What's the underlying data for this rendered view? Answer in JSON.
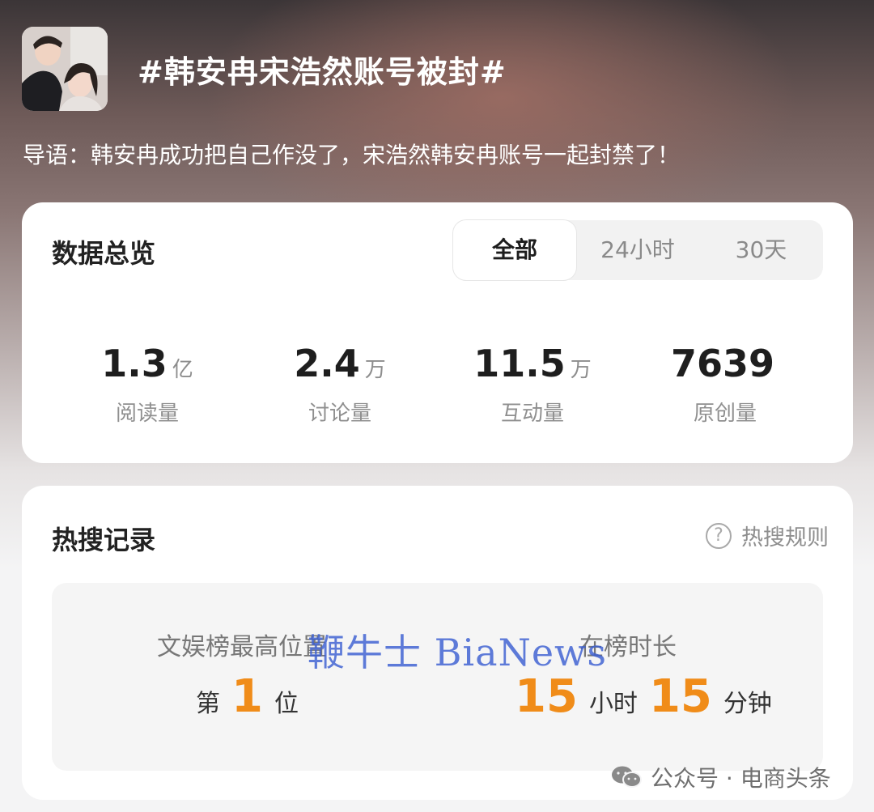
{
  "topic": {
    "title": "#韩安冉宋浩然账号被封#",
    "lead": "导语：韩安冉成功把自己作没了，宋浩然韩安冉账号一起封禁了！"
  },
  "overview": {
    "title": "数据总览",
    "tabs": [
      {
        "label": "全部",
        "active": true
      },
      {
        "label": "24小时",
        "active": false
      },
      {
        "label": "30天",
        "active": false
      }
    ],
    "stats": [
      {
        "value": "1.3",
        "unit": "亿",
        "label": "阅读量"
      },
      {
        "value": "2.4",
        "unit": "万",
        "label": "讨论量"
      },
      {
        "value": "11.5",
        "unit": "万",
        "label": "互动量"
      },
      {
        "value": "7639",
        "unit": "",
        "label": "原创量"
      }
    ]
  },
  "hot_search": {
    "title": "热搜记录",
    "rules_link": "热搜规则",
    "rules_icon": "question-circle-icon",
    "highest_position": {
      "label": "文娱榜最高位置",
      "prefix": "第",
      "value": "1",
      "suffix": "位"
    },
    "duration": {
      "label": "在榜时长",
      "hours": "15",
      "hours_unit": "小时",
      "minutes": "15",
      "minutes_unit": "分钟"
    }
  },
  "watermark": "鞭牛士 BiaNews",
  "source": "公众号 · 电商头条",
  "colors": {
    "accent_orange": "#f08c19",
    "watermark_blue": "#3c5fd2"
  }
}
